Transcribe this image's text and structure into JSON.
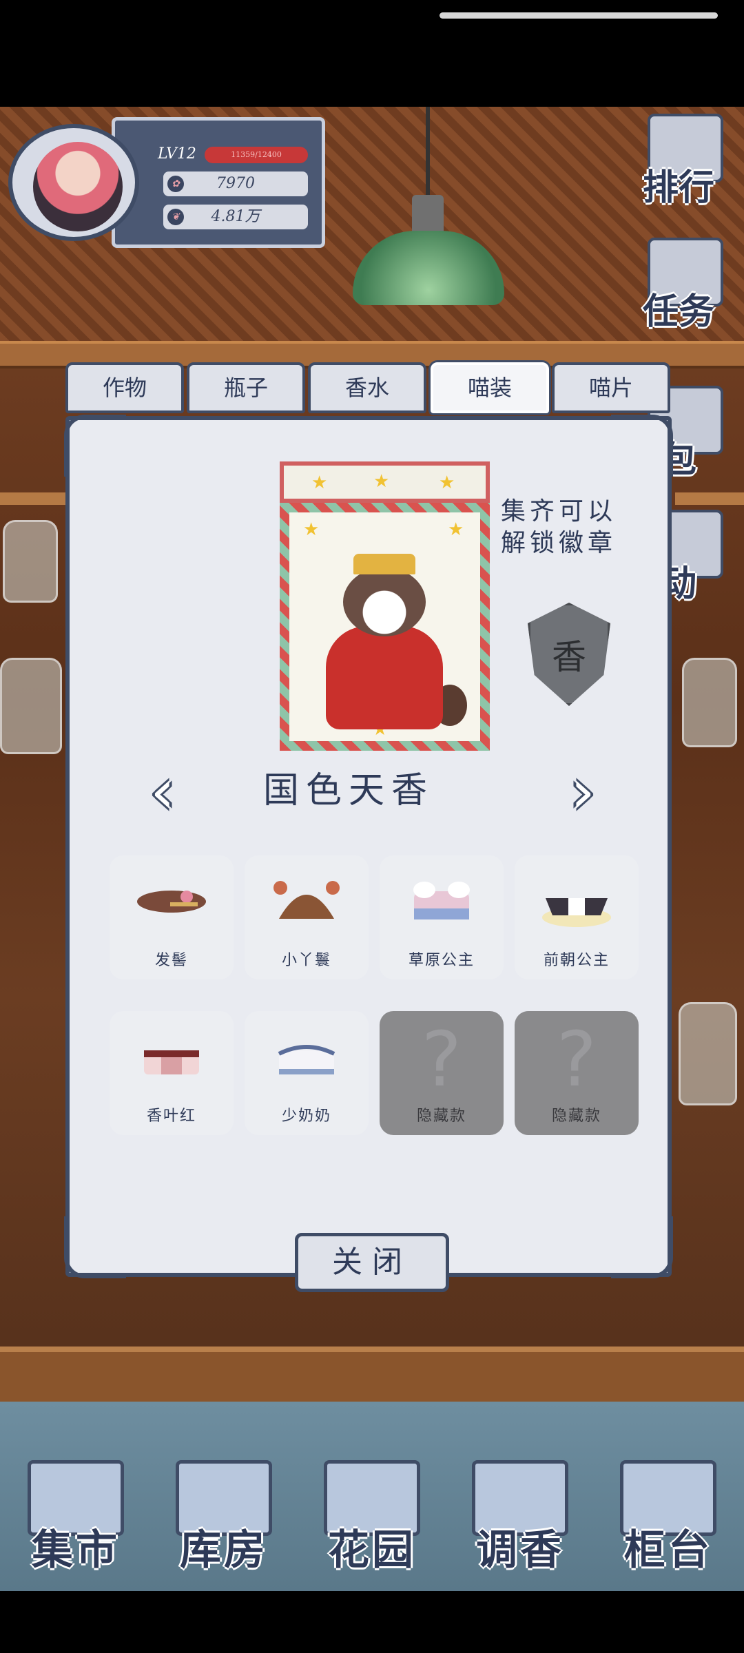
{
  "player": {
    "level": "LV12",
    "xp_text": "11359/12400",
    "petals": "7970",
    "money": "4.81万"
  },
  "side_menu": [
    {
      "label": "排行",
      "icon": "ranking-icon"
    },
    {
      "label": "任务",
      "icon": "task-icon"
    },
    {
      "label": "包",
      "icon": "bag-icon"
    },
    {
      "label": "动",
      "icon": "event-icon"
    }
  ],
  "tabs": [
    {
      "label": "作物",
      "active": false
    },
    {
      "label": "瓶子",
      "active": false
    },
    {
      "label": "香水",
      "active": false
    },
    {
      "label": "喵装",
      "active": true
    },
    {
      "label": "喵片",
      "active": false
    }
  ],
  "collection": {
    "hint": "集齐可以解锁徽章",
    "badge_char": "香",
    "set_name": "国色天香",
    "prev_arrow": "‹",
    "next_arrow": "›",
    "items": [
      {
        "label": "发髻",
        "locked": false,
        "icon": "hair-bun-icon",
        "color": "#8a5a4a"
      },
      {
        "label": "小丫鬟",
        "locked": false,
        "icon": "pigtails-icon",
        "color": "#8a5535"
      },
      {
        "label": "草原公主",
        "locked": false,
        "icon": "grassland-dress-icon",
        "color": "#8fa6d6"
      },
      {
        "label": "前朝公主",
        "locked": false,
        "icon": "royal-dress-icon",
        "color": "#3a3540"
      },
      {
        "label": "香叶红",
        "locked": false,
        "icon": "red-dress-icon",
        "color": "#d9a0a4"
      },
      {
        "label": "少奶奶",
        "locked": false,
        "icon": "lady-dress-icon",
        "color": "#8aa0c8"
      },
      {
        "label": "隐藏款",
        "locked": true,
        "icon": "question-icon",
        "color": "#8a8a8c"
      },
      {
        "label": "隐藏款",
        "locked": true,
        "icon": "question-icon",
        "color": "#8a8a8c"
      }
    ]
  },
  "close_label": "关闭",
  "bottom_nav": [
    {
      "label": "集市",
      "icon": "market-icon"
    },
    {
      "label": "库房",
      "icon": "warehouse-icon"
    },
    {
      "label": "花园",
      "icon": "garden-icon"
    },
    {
      "label": "调香",
      "icon": "perfume-icon"
    },
    {
      "label": "柜台",
      "icon": "counter-icon"
    }
  ],
  "colors": {
    "accent": "#3f4c66",
    "xp_bar": "#c73838"
  }
}
